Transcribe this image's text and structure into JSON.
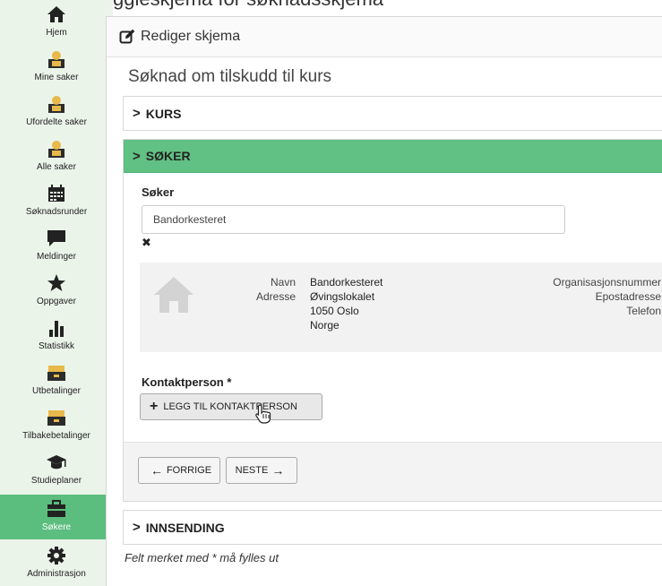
{
  "header_cropped": "ggleskjema for søknadsskjema",
  "sidebar": {
    "items": [
      {
        "label": "Hjem",
        "icon": "home-icon"
      },
      {
        "label": "Mine saker",
        "icon": "user-folder-icon"
      },
      {
        "label": "Ufordelte saker",
        "icon": "user-folder-icon"
      },
      {
        "label": "Alle saker",
        "icon": "user-folder-icon"
      },
      {
        "label": "Søknadsrunder",
        "icon": "calendar-icon"
      },
      {
        "label": "Meldinger",
        "icon": "chat-icon"
      },
      {
        "label": "Oppgaver",
        "icon": "star-icon"
      },
      {
        "label": "Statistikk",
        "icon": "bar-chart-icon"
      },
      {
        "label": "Utbetalinger",
        "icon": "money-icon"
      },
      {
        "label": "Tilbakebetalinger",
        "icon": "money-icon"
      },
      {
        "label": "Studieplaner",
        "icon": "graduation-cap-icon"
      },
      {
        "label": "Søkere",
        "icon": "briefcase-icon",
        "active": true
      },
      {
        "label": "Administrasjon",
        "icon": "gear-icon"
      }
    ]
  },
  "panel": {
    "title": "Rediger skjema",
    "form_title": "Søknad om tilskudd til kurs"
  },
  "sections": {
    "kurs": "KURS",
    "soker": "SØKER",
    "innsending": "INNSENDING"
  },
  "soker": {
    "label": "Søker",
    "value": "Bandorkesteret",
    "clear": "✖",
    "info": {
      "navn_key": "Navn",
      "adresse_key": "Adresse",
      "navn_val": "Bandorkesteret",
      "adresse_line1": "Øvingslokalet",
      "adresse_line2": "1050 Oslo",
      "adresse_line3": "Norge",
      "orgnr_key": "Organisasjonsnummer",
      "epost_key": "Epostadresse",
      "telefon_key": "Telefon"
    },
    "kontakt_label": "Kontaktperson *",
    "add_contact_label": "LEGG TIL KONTAKTPERSON"
  },
  "nav": {
    "prev_label": "FORRIGE",
    "next_label": "NESTE"
  },
  "footnote": "Felt merket med * må fylles ut",
  "colors": {
    "sidebar_bg": "#eaf4e9",
    "active_green": "#5bbd7e",
    "section_green": "#61c083"
  }
}
